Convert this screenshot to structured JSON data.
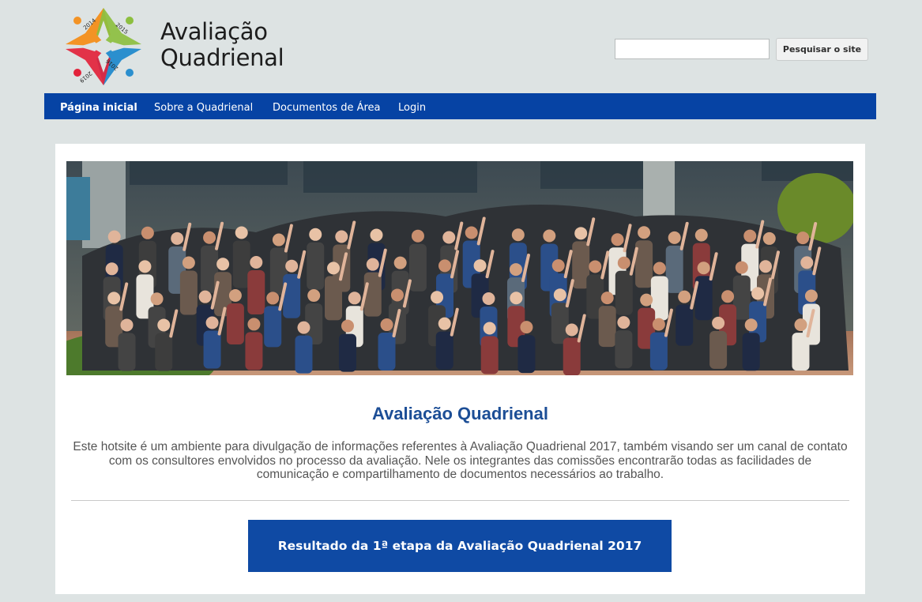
{
  "header": {
    "title_line1": "Avaliação",
    "title_line2": "Quadrienal",
    "logo_years": [
      "2014",
      "2015",
      "2016",
      "2019"
    ]
  },
  "search": {
    "value": "",
    "placeholder": "",
    "button_label": "Pesquisar o site"
  },
  "nav": {
    "items": [
      {
        "label": "Página inicial",
        "active": true
      },
      {
        "label": "Sobre a Quadrienal",
        "active": false
      },
      {
        "label": "Documentos de Área",
        "active": false
      },
      {
        "label": "Login",
        "active": false
      }
    ]
  },
  "main": {
    "heading": "Avaliação Quadrienal",
    "intro": "Este hotsite é um ambiente para divulgação de informações referentes à Avaliação Quadrienal 2017, também visando ser um canal de contato com os consultores envolvidos no processo da avaliação. Nele os integrantes das comissões encontrarão todas as facilidades de comunicação e compartilhamento de documentos necessários ao trabalho.",
    "cta_label": "Resultado da 1ª etapa da Avaliação Quadrienal 2017"
  },
  "colors": {
    "nav_bg": "#0643a4",
    "heading": "#1c4e96",
    "cta_bg": "#0f4aa4",
    "page_bg": "#dde3e3",
    "logo_orange": "#f39325",
    "logo_green": "#8cbf3f",
    "logo_red": "#e2233b",
    "logo_blue": "#2b8fce"
  }
}
